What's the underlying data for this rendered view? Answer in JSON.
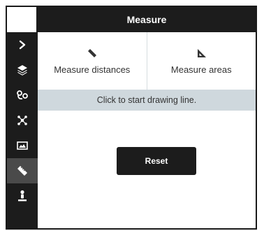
{
  "header": {
    "title": "Measure"
  },
  "sidebar": {
    "items": [
      {
        "icon": "chevron-right-icon",
        "active": false
      },
      {
        "icon": "layers-icon",
        "active": false
      },
      {
        "icon": "route-icon",
        "active": false
      },
      {
        "icon": "network-icon",
        "active": false
      },
      {
        "icon": "map-image-icon",
        "active": false
      },
      {
        "icon": "ruler-icon",
        "active": true
      },
      {
        "icon": "person-pin-icon",
        "active": false
      }
    ]
  },
  "tabs": [
    {
      "label": "Measure distances",
      "icon": "ruler-icon"
    },
    {
      "label": "Measure areas",
      "icon": "set-square-icon"
    }
  ],
  "status": {
    "text": "Click to start drawing line."
  },
  "actions": {
    "reset_label": "Reset"
  },
  "colors": {
    "dark": "#1c1c1c",
    "active_side": "#4a4a4a",
    "status_bg": "#cfd8dd"
  }
}
